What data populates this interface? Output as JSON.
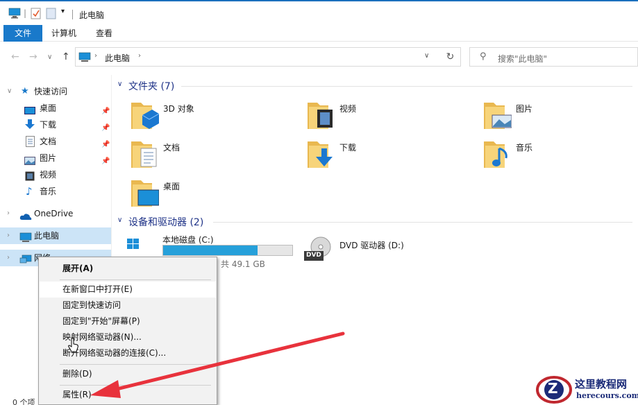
{
  "window": {
    "title": "此电脑"
  },
  "ribbon": {
    "tabs": [
      "文件",
      "计算机",
      "查看"
    ]
  },
  "address": {
    "path": [
      "此电脑"
    ],
    "search_placeholder": "搜索\"此电脑\""
  },
  "sidebar": {
    "quick_access": "快速访问",
    "items": [
      "桌面",
      "下载",
      "文档",
      "图片",
      "视频",
      "音乐"
    ],
    "onedrive": "OneDrive",
    "this_pc": "此电脑",
    "network": "网络"
  },
  "content": {
    "folders_header": "文件夹 (7)",
    "folders": [
      "3D 对象",
      "视频",
      "图片",
      "文档",
      "下载",
      "音乐",
      "桌面"
    ],
    "devices_header": "设备和驱动器 (2)",
    "drive_c": {
      "label": "本地磁盘 (C:)",
      "size_text": "共 49.1 GB",
      "used_fraction": 0.73
    },
    "drive_d": {
      "label": "DVD 驱动器 (D:)",
      "badge": "DVD"
    }
  },
  "context_menu": {
    "items": [
      "展开(A)",
      "在新窗口中打开(E)",
      "固定到快速访问",
      "固定到\"开始\"屏幕(P)",
      "映射网络驱动器(N)...",
      "断开网络驱动器的连接(C)...",
      "删除(D)",
      "属性(R)"
    ]
  },
  "status": {
    "items_text": "0 个项"
  },
  "watermark": {
    "title": "这里教程网",
    "url": "herecours.com",
    "logo_letter": "Z"
  },
  "colors": {
    "accent": "#1979ca",
    "selection": "#cce4f7",
    "arrow": "#e8323c",
    "folder": "#f3c660"
  }
}
